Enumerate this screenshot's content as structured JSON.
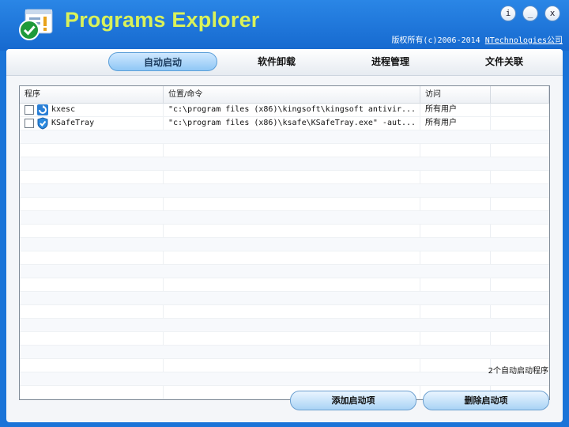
{
  "app": {
    "title": "Programs Explorer",
    "copyright_prefix": "版权所有(c)2006-2014 ",
    "copyright_link": "NTechnologies公司",
    "icon": "programs-explorer-logo"
  },
  "window_buttons": {
    "info": "i",
    "minimize": "_",
    "close": "x"
  },
  "tabs": [
    {
      "label": "自动启动",
      "active": true
    },
    {
      "label": "软件卸载",
      "active": false
    },
    {
      "label": "进程管理",
      "active": false
    },
    {
      "label": "文件关联",
      "active": false
    }
  ],
  "columns": {
    "program": "程序",
    "location": "位置/命令",
    "access": "访问"
  },
  "rows": [
    {
      "checked": false,
      "icon": "kxesc-app-icon",
      "name": "kxesc",
      "location": "\"c:\\program files (x86)\\kingsoft\\kingsoft antivir...",
      "access": "所有用户"
    },
    {
      "checked": false,
      "icon": "ksafetray-shield-icon",
      "name": "KSafeTray",
      "location": "\"c:\\program files (x86)\\ksafe\\KSafeTray.exe\" -aut...",
      "access": "所有用户"
    }
  ],
  "status_text": "2个自动启动程序",
  "buttons": {
    "add": "添加启动项",
    "remove": "删除启动项"
  },
  "colors": {
    "window_blue": "#1a74d8",
    "title_text": "#d9f25a"
  }
}
